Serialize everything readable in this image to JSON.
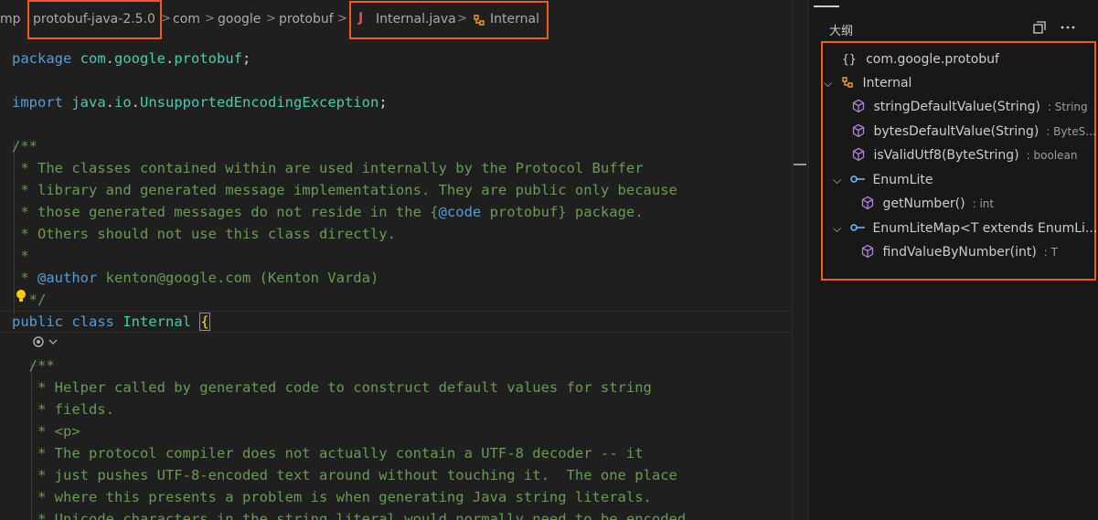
{
  "breadcrumb": {
    "items": [
      "mp",
      "protobuf-java-2.5.0",
      "com",
      "google",
      "protobuf",
      "Internal.java",
      "Internal"
    ],
    "java_icon": "J",
    "separator": ">"
  },
  "editor": {
    "lines": [
      {
        "segments": [
          {
            "t": "package ",
            "c": "kw"
          },
          {
            "t": "com",
            "c": "ty"
          },
          {
            "t": ".",
            "c": "pl"
          },
          {
            "t": "google",
            "c": "ty"
          },
          {
            "t": ".",
            "c": "pl"
          },
          {
            "t": "protobuf",
            "c": "ty"
          },
          {
            "t": ";",
            "c": "pl"
          }
        ]
      },
      {
        "segments": []
      },
      {
        "segments": [
          {
            "t": "import ",
            "c": "kw"
          },
          {
            "t": "java",
            "c": "ty"
          },
          {
            "t": ".",
            "c": "pl"
          },
          {
            "t": "io",
            "c": "ty"
          },
          {
            "t": ".",
            "c": "pl"
          },
          {
            "t": "UnsupportedEncodingException",
            "c": "ty"
          },
          {
            "t": ";",
            "c": "pl"
          }
        ]
      },
      {
        "segments": []
      },
      {
        "segments": [
          {
            "t": "/**",
            "c": "cm"
          }
        ]
      },
      {
        "segments": [
          {
            "t": " * The classes contained within are used internally by the Protocol Buffer",
            "c": "cm"
          }
        ]
      },
      {
        "segments": [
          {
            "t": " * library and generated message implementations. They are public only because",
            "c": "cm"
          }
        ]
      },
      {
        "segments": [
          {
            "t": " * those generated messages do not reside in the {",
            "c": "cm"
          },
          {
            "t": "@code",
            "c": "tag"
          },
          {
            "t": " protobuf} package.",
            "c": "cm"
          }
        ]
      },
      {
        "segments": [
          {
            "t": " * Others should not use this class directly.",
            "c": "cm"
          }
        ]
      },
      {
        "segments": [
          {
            "t": " *",
            "c": "cm"
          }
        ]
      },
      {
        "segments": [
          {
            "t": " * ",
            "c": "cm"
          },
          {
            "t": "@author",
            "c": "tag"
          },
          {
            "t": " kenton@google.com (Kenton Varda)",
            "c": "cm"
          }
        ]
      },
      {
        "segments": [
          {
            "t": "  */",
            "c": "cm"
          }
        ]
      },
      {
        "segments": [
          {
            "t": "public ",
            "c": "kw"
          },
          {
            "t": "class ",
            "c": "kw"
          },
          {
            "t": "Internal ",
            "c": "ty"
          }
        ]
      },
      {
        "segments": []
      },
      {
        "segments": [
          {
            "t": "  /**",
            "c": "cm"
          }
        ]
      },
      {
        "segments": [
          {
            "t": "   * Helper called by generated code to construct default values for string",
            "c": "cm"
          }
        ]
      },
      {
        "segments": [
          {
            "t": "   * fields.",
            "c": "cm"
          }
        ]
      },
      {
        "segments": [
          {
            "t": "   * <p>",
            "c": "cm"
          }
        ]
      },
      {
        "segments": [
          {
            "t": "   * The protocol compiler does not actually contain a UTF-8 decoder -- it",
            "c": "cm"
          }
        ]
      },
      {
        "segments": [
          {
            "t": "   * just pushes UTF-8-encoded text around without touching it.  The one place",
            "c": "cm"
          }
        ]
      },
      {
        "segments": [
          {
            "t": "   * where this presents a problem is when generating Java string literals.",
            "c": "cm"
          }
        ]
      },
      {
        "segments": [
          {
            "t": "   * Unicode characters in the string literal would normally need to be encoded",
            "c": "cm"
          }
        ]
      }
    ],
    "open_brace": "{"
  },
  "outline": {
    "title": "大纲",
    "items": [
      {
        "label": "com.google.protobuf",
        "detail": "",
        "icon": "namespace-icon"
      },
      {
        "label": "Internal",
        "detail": "",
        "icon": "class-icon"
      },
      {
        "label": "stringDefaultValue(String)",
        "detail": ": String",
        "icon": "method-icon"
      },
      {
        "label": "bytesDefaultValue(String)",
        "detail": ": ByteS...",
        "icon": "method-icon"
      },
      {
        "label": "isValidUtf8(ByteString)",
        "detail": ": boolean",
        "icon": "method-icon"
      },
      {
        "label": "EnumLite",
        "detail": "",
        "icon": "interface-icon"
      },
      {
        "label": "getNumber()",
        "detail": ": int",
        "icon": "method-icon"
      },
      {
        "label": "EnumLiteMap<T extends EnumLi...",
        "detail": "",
        "icon": "interface-icon"
      },
      {
        "label": "findValueByNumber(int)",
        "detail": ": T",
        "icon": "method-icon"
      }
    ]
  },
  "colors": {
    "highlight": "#f05a23",
    "method": "#b180d7",
    "class": "#ee9d28",
    "interface": "#75beff"
  }
}
